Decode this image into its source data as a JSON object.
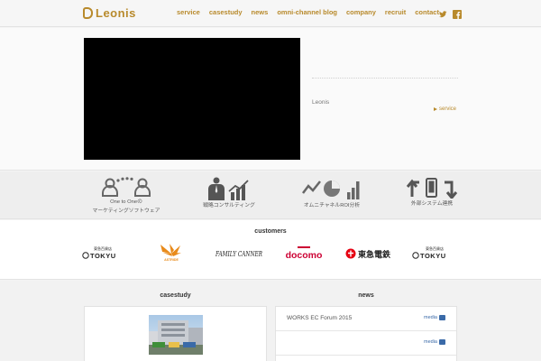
{
  "brand": {
    "name": "Leonis",
    "accent": "#b88a2c"
  },
  "nav": [
    "service",
    "casestudy",
    "news",
    "omni-channel blog",
    "company",
    "recruit",
    "contact"
  ],
  "social": [
    "twitter-icon",
    "facebook-icon"
  ],
  "hero": {
    "label": "Leonis",
    "link": "service"
  },
  "services": [
    {
      "icon": "people-connect-icon",
      "label1": "One to Oneの",
      "label2": "マーケティングソフトウェア"
    },
    {
      "icon": "consultant-chart-icon",
      "label1": "戦略コンサルティング",
      "label2": ""
    },
    {
      "icon": "analytics-icon",
      "label1": "オムニチャネルROI分析",
      "label2": ""
    },
    {
      "icon": "system-integration-icon",
      "label1": "外部システム連携",
      "label2": ""
    }
  ],
  "customers": {
    "title": "customers",
    "logos": [
      {
        "name": "TOKYU",
        "sub": "東急百貨店"
      },
      {
        "name": "ASTRIDE",
        "sub": ""
      },
      {
        "name": "FAMILY CANNER",
        "sub": ""
      },
      {
        "name": "docomo",
        "sub": ""
      },
      {
        "name": "東急電鉄",
        "sub": ""
      },
      {
        "name": "TOKYU",
        "sub": "東急百貨店"
      }
    ]
  },
  "casestudy": {
    "title": "casestudy"
  },
  "news": {
    "title": "news",
    "items": [
      {
        "text": "WORKS EC Forum 2015",
        "badge": "media"
      },
      {
        "text": "",
        "badge": "media"
      }
    ]
  }
}
